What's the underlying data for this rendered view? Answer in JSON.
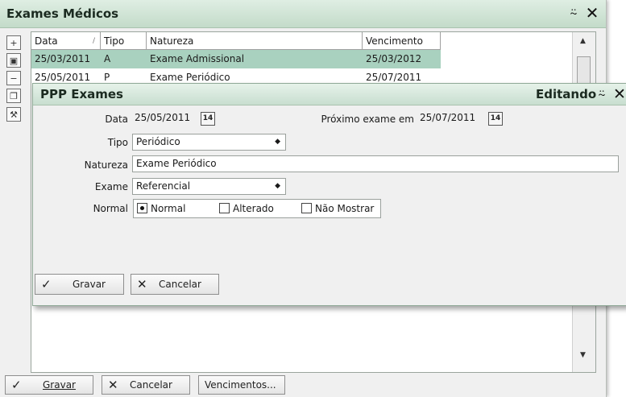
{
  "window": {
    "title": "Exames Médicos",
    "pin_icon": "pin-icon",
    "close_icon": "close-icon"
  },
  "toolbar": {
    "items": [
      "add-icon",
      "edit-icon",
      "remove-icon",
      "copy-icon",
      "tools-icon"
    ]
  },
  "grid": {
    "columns": [
      "Data",
      "Tipo",
      "Natureza",
      "Vencimento"
    ],
    "sort_indicator": "/",
    "rows": [
      {
        "data": "25/03/2011",
        "tipo": "A",
        "natureza": "Exame Admissional",
        "vencimento": "25/03/2012",
        "selected": true
      },
      {
        "data": "25/05/2011",
        "tipo": "P",
        "natureza": "Exame Periódico",
        "vencimento": "25/07/2011",
        "selected": false
      }
    ]
  },
  "buttons": {
    "gravar": "Gravar",
    "cancelar": "Cancelar",
    "vencimentos": "Vencimentos..."
  },
  "dialog": {
    "title": "PPP Exames",
    "status": "Editando",
    "fields": {
      "data_label": "Data",
      "data_value": "25/05/2011",
      "proximo_label": "Próximo exame em",
      "proximo_value": "25/07/2011",
      "calendar_label": "14",
      "tipo_label": "Tipo",
      "tipo_value": "Periódico",
      "natureza_label": "Natureza",
      "natureza_value": "Exame Periódico",
      "exame_label": "Exame",
      "exame_value": "Referencial",
      "normal_label": "Normal"
    },
    "normal_options": [
      "Normal",
      "Alterado",
      "Não Mostrar"
    ],
    "normal_selected": "Normal",
    "buttons": {
      "gravar": "Gravar",
      "cancelar": "Cancelar"
    }
  }
}
